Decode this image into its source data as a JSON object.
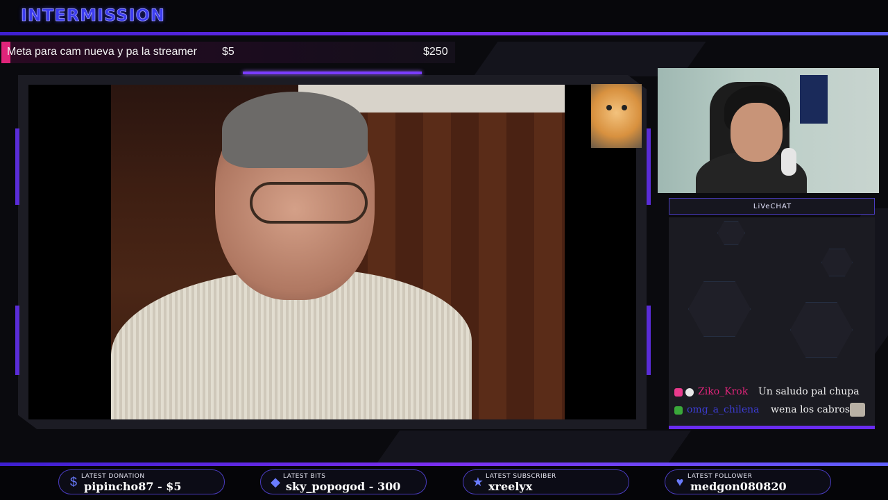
{
  "header": {
    "title": "INTERMISSION"
  },
  "goal": {
    "label": "Meta para cam nueva y pa la streamer",
    "current": "$5",
    "target": "$250",
    "progress_fraction": 0.02
  },
  "chat": {
    "title": "LiVeCHAT",
    "messages": [
      {
        "user": "Ziko_Krok",
        "user_color": "#e0247a",
        "text": "Un saludo pal chupa"
      },
      {
        "user": "omg_a_chilena",
        "user_color": "#3d3dd6",
        "text": "wena los cabros"
      }
    ]
  },
  "footer": {
    "stats": [
      {
        "label": "LATEST DONATION",
        "value": "pipincho87 - $5",
        "icon": "dollar-icon",
        "glyph": "$"
      },
      {
        "label": "LATEST BITS",
        "value": "sky_popogod - 300",
        "icon": "diamond-icon",
        "glyph": "◆"
      },
      {
        "label": "LATEST SUBSCRIBER",
        "value": "xreelyx",
        "icon": "star-icon",
        "glyph": "★"
      },
      {
        "label": "LATEST FOLLOWER",
        "value": "medgon080820",
        "icon": "heart-icon",
        "glyph": "♥"
      }
    ]
  },
  "colors": {
    "accent": "#6a2cf0",
    "title": "#3c3cf0",
    "goal_fill": "#e0247a"
  }
}
